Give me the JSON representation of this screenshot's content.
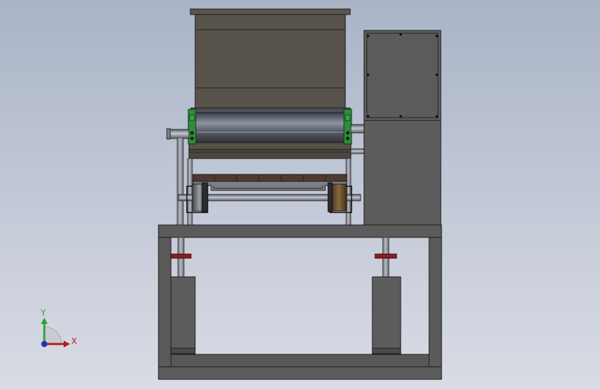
{
  "view": {
    "background_top": "#a9b4c7",
    "background_bottom": "#d9dce5"
  },
  "triad": {
    "x_label": "X",
    "y_label": "Y",
    "x_color": "#b01e1e",
    "y_color": "#2aa43a",
    "z_color": "#2630b8"
  },
  "model": {
    "parts": [
      "hopper",
      "feed-roller",
      "side-bearing-left",
      "side-bearing-right",
      "control-cabinet",
      "tray",
      "bottom-shaft",
      "pulley-left",
      "pulley-right",
      "frame",
      "support-leg-left",
      "support-leg-right"
    ],
    "colors": {
      "hopper": "#57534b",
      "roller": "#5d6470",
      "bearing": "#2f8c3b",
      "cabinet": "#5e5e5e",
      "tray": "#4e3a34",
      "frame": "#5b5b5b",
      "shaft": "#8c9099",
      "pulley": "#6a5131",
      "clamp": "#8b1e22"
    }
  }
}
